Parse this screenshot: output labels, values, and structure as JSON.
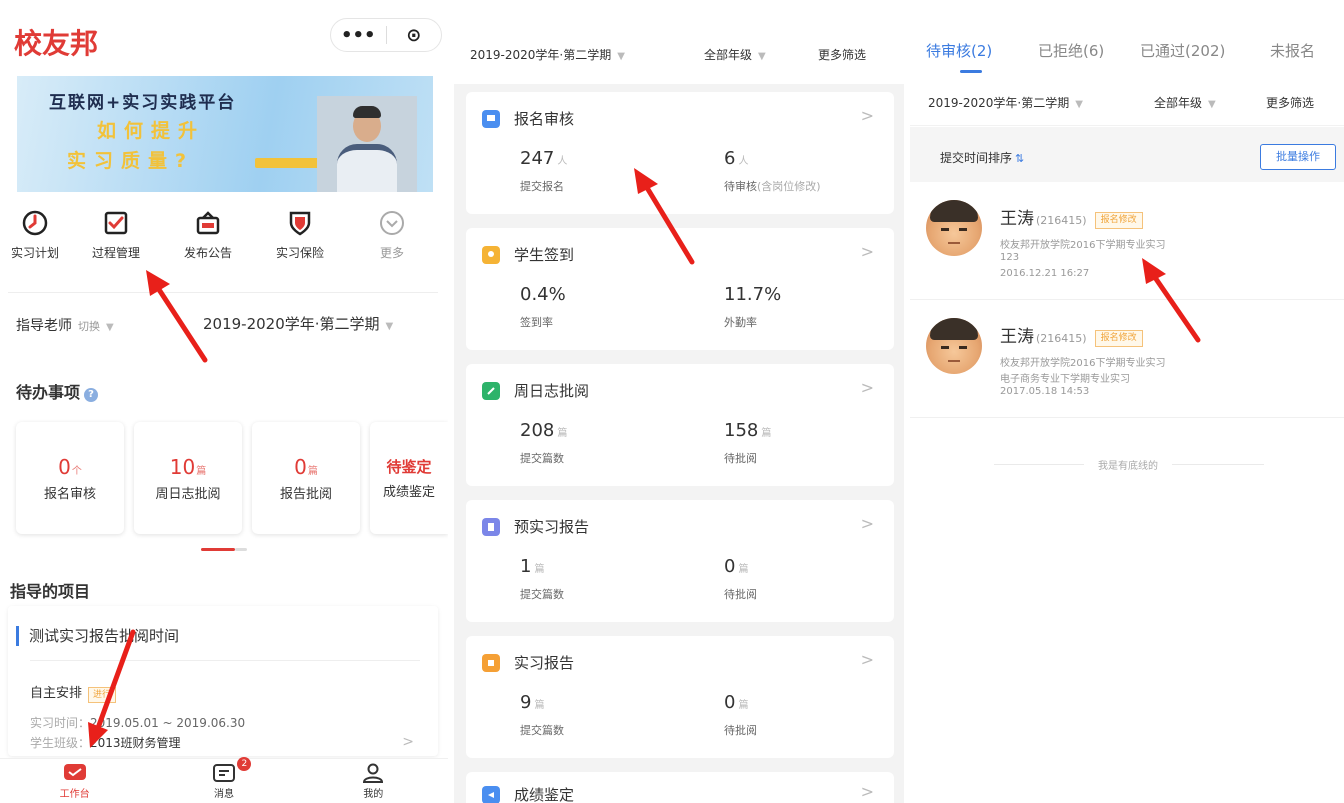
{
  "panel1": {
    "app_title": "校友邦",
    "capsule": {
      "more": "•••",
      "close": "⊙"
    },
    "banner": {
      "line1": "互联网+实习实践平台",
      "line2": "如何提升",
      "line3": "实习质量?"
    },
    "menu": [
      {
        "label": "实习计划",
        "icon": "clock-icon"
      },
      {
        "label": "过程管理",
        "icon": "checklist-icon"
      },
      {
        "label": "发布公告",
        "icon": "announcement-icon"
      },
      {
        "label": "实习保险",
        "icon": "shield-icon"
      },
      {
        "label": "更多",
        "icon": "more-icon"
      }
    ],
    "teacher": {
      "label": "指导老师",
      "switch": "切换",
      "term": "2019-2020学年·第二学期"
    },
    "todo": {
      "title": "待办事项",
      "cards": [
        {
          "value": "0",
          "unit": "个",
          "label": "报名审核"
        },
        {
          "value": "10",
          "unit": "篇",
          "label": "周日志批阅"
        },
        {
          "value": "0",
          "unit": "篇",
          "label": "报告批阅"
        },
        {
          "value": "待鉴定",
          "unit": "",
          "label": "成绩鉴定"
        }
      ]
    },
    "projects": {
      "title": "指导的项目",
      "item": {
        "name": "测试实习报告批阅时间",
        "arrangement": "自主安排",
        "arrangement_tag": "进行",
        "time_key": "实习时间：",
        "time_value": "2019.05.01 ~ 2019.06.30",
        "class_key": "学生班级：",
        "class_value": "2013班财务管理"
      }
    },
    "tabbar": {
      "workbench": "工作台",
      "messages": "消息",
      "messages_badge": "2",
      "mine": "我的"
    }
  },
  "panel2": {
    "filter": {
      "term": "2019-2020学年·第二学期",
      "grade": "全部年级",
      "more": "更多筛选"
    },
    "cards": [
      {
        "title": "报名审核",
        "color": "#4a8ef0",
        "icon": "flag-icon",
        "left_value": "247",
        "left_unit": "人",
        "left_label": "提交报名",
        "right_value": "6",
        "right_unit": "人",
        "right_label": "待审核",
        "right_note": "(含岗位修改)"
      },
      {
        "title": "学生签到",
        "color": "#f5b335",
        "icon": "location-icon",
        "left_value": "0.4%",
        "left_unit": "",
        "left_label": "签到率",
        "right_value": "11.7%",
        "right_unit": "",
        "right_label": "外勤率",
        "right_note": ""
      },
      {
        "title": "周日志批阅",
        "color": "#2db36a",
        "icon": "pen-icon",
        "left_value": "208",
        "left_unit": "篇",
        "left_label": "提交篇数",
        "right_value": "158",
        "right_unit": "篇",
        "right_label": "待批阅",
        "right_note": ""
      },
      {
        "title": "预实习报告",
        "color": "#7b86e8",
        "icon": "document-icon",
        "left_value": "1",
        "left_unit": "篇",
        "left_label": "提交篇数",
        "right_value": "0",
        "right_unit": "篇",
        "right_label": "待批阅",
        "right_note": ""
      },
      {
        "title": "实习报告",
        "color": "#f5a035",
        "icon": "report-icon",
        "left_value": "9",
        "left_unit": "篇",
        "left_label": "提交篇数",
        "right_value": "0",
        "right_unit": "篇",
        "right_label": "待批阅",
        "right_note": ""
      },
      {
        "title": "成绩鉴定",
        "color": "#4a8ef0",
        "icon": "grade-icon",
        "left_value": "",
        "left_unit": "",
        "left_label": "",
        "right_value": "",
        "right_unit": "",
        "right_label": "",
        "right_note": ""
      }
    ]
  },
  "panel3": {
    "tabs": [
      {
        "label": "待审核(2)"
      },
      {
        "label": "已拒绝(6)"
      },
      {
        "label": "已通过(202)"
      },
      {
        "label": "未报名"
      }
    ],
    "filter": {
      "term": "2019-2020学年·第二学期",
      "grade": "全部年级",
      "more": "更多筛选"
    },
    "sort_label": "提交时间排序",
    "batch_button": "批量操作",
    "entries": [
      {
        "name": "王涛",
        "id": "(216415)",
        "tag": "报名修改",
        "line1": "校友邦开放学院2016下学期专业实习",
        "line2": "123",
        "time": "2016.12.21 16:27"
      },
      {
        "name": "王涛",
        "id": "(216415)",
        "tag": "报名修改",
        "line1": "校友邦开放学院2016下学期专业实习",
        "line2": "电子商务专业下学期专业实习",
        "time": "2017.05.18 14:53"
      }
    ],
    "end_text": "我是有底线的"
  },
  "colors": {
    "brand_red": "#e03b36",
    "accent_blue": "#3b7be0",
    "tag_orange": "#f0a43a",
    "arrow_red": "#e8201a"
  }
}
